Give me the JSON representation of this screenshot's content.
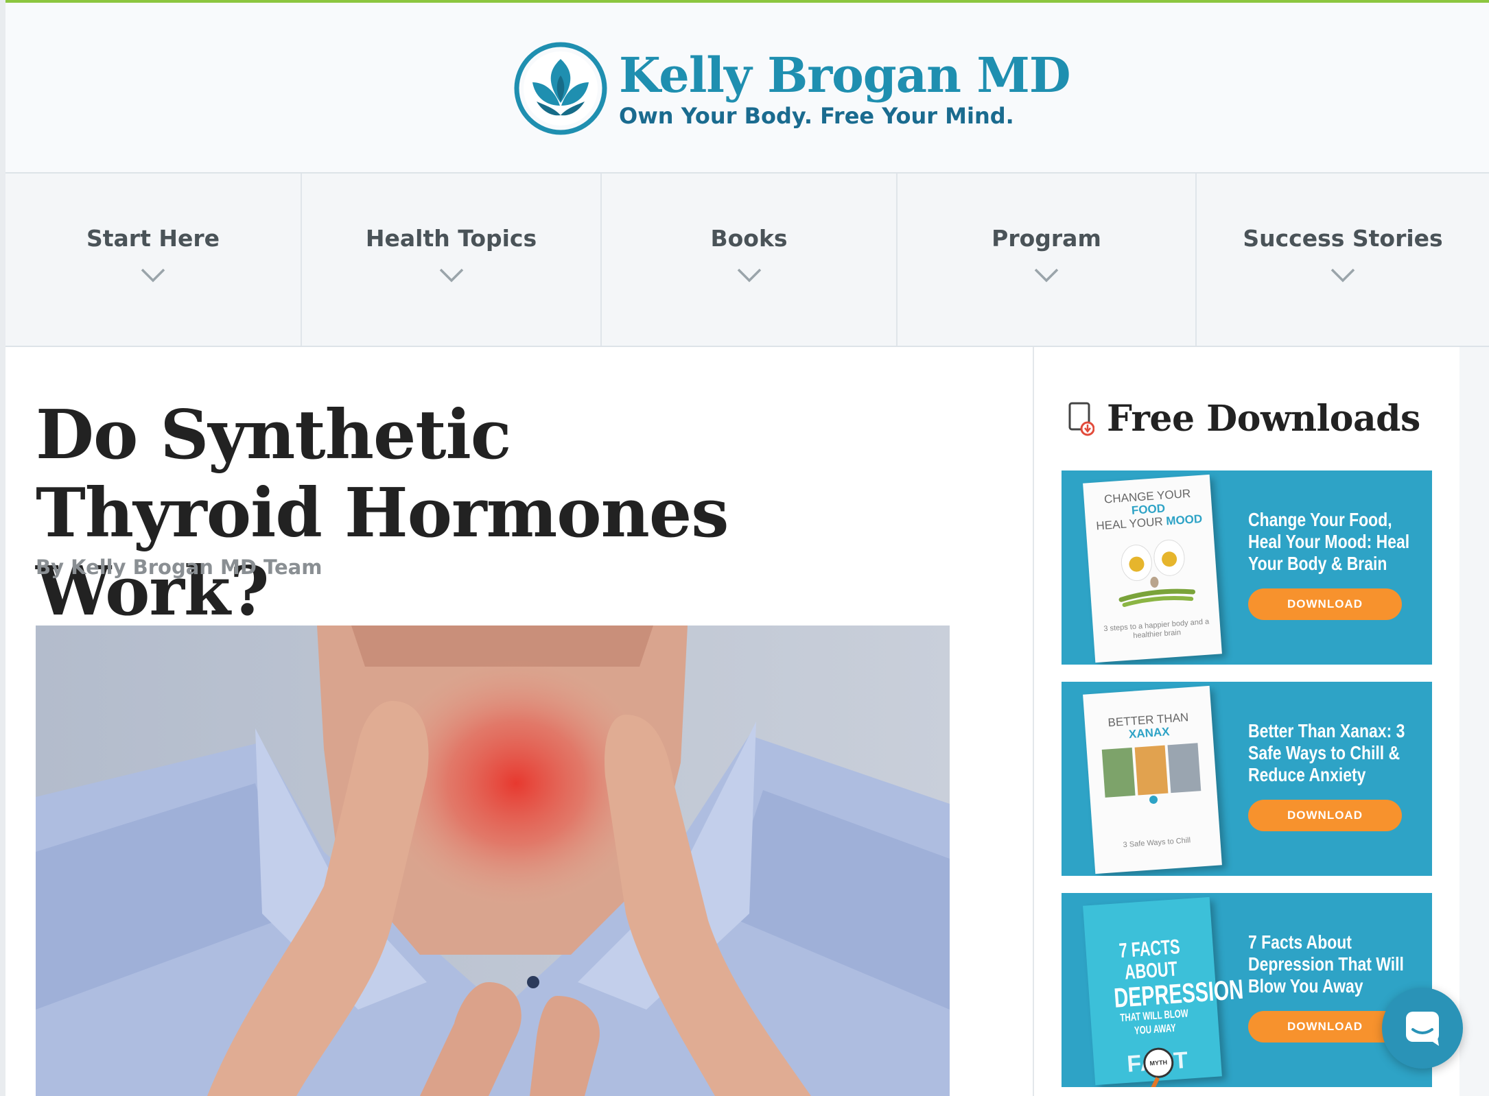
{
  "brand": {
    "name": "Kelly Brogan MD",
    "tagline": "Own Your Body. Free Your Mind.",
    "colors": {
      "primary": "#1f8fb0",
      "accent": "#f7922d",
      "topbar": "#8cc63f"
    }
  },
  "nav": {
    "items": [
      {
        "label": "Start Here",
        "icon": "chevron-down-icon"
      },
      {
        "label": "Health Topics",
        "icon": "chevron-down-icon"
      },
      {
        "label": "Books",
        "icon": "chevron-down-icon"
      },
      {
        "label": "Program",
        "icon": "chevron-down-icon"
      },
      {
        "label": "Success Stories",
        "icon": "chevron-down-icon"
      }
    ]
  },
  "article": {
    "title": "Do Synthetic Thyroid Hormones Work?",
    "byline": "By Kelly Brogan MD Team"
  },
  "sidebar": {
    "title": "Free Downloads",
    "icon": "download-document-icon",
    "downloads": [
      {
        "title": "Change Your Food, Heal Your Mood: Heal Your Body & Brain",
        "button": "DOWNLOAD",
        "book_title_a": "CHANGE YOUR ",
        "book_title_a_hl": "FOOD",
        "book_title_b": "HEAL YOUR ",
        "book_title_b_hl": "MOOD",
        "book_sub": "3 steps to a happier body and a healthier brain"
      },
      {
        "title": "Better Than Xanax: 3 Safe Ways to Chill & Reduce Anxiety",
        "button": "DOWNLOAD",
        "book_title_a": "BETTER THAN ",
        "book_title_a_hl": "XANAX",
        "book_sub": "3 Safe Ways to Chill"
      },
      {
        "title": "7 Facts About Depression That Will Blow You Away",
        "button": "DOWNLOAD",
        "book_title_a": "7 FACTS ABOUT",
        "book_title_b": "DEPRESSION",
        "book_sub": "THAT WILL BLOW YOU AWAY",
        "book_myth": "MYTH",
        "book_fact": "FACT"
      }
    ]
  },
  "chat": {
    "icon": "chat-bubble-icon"
  }
}
